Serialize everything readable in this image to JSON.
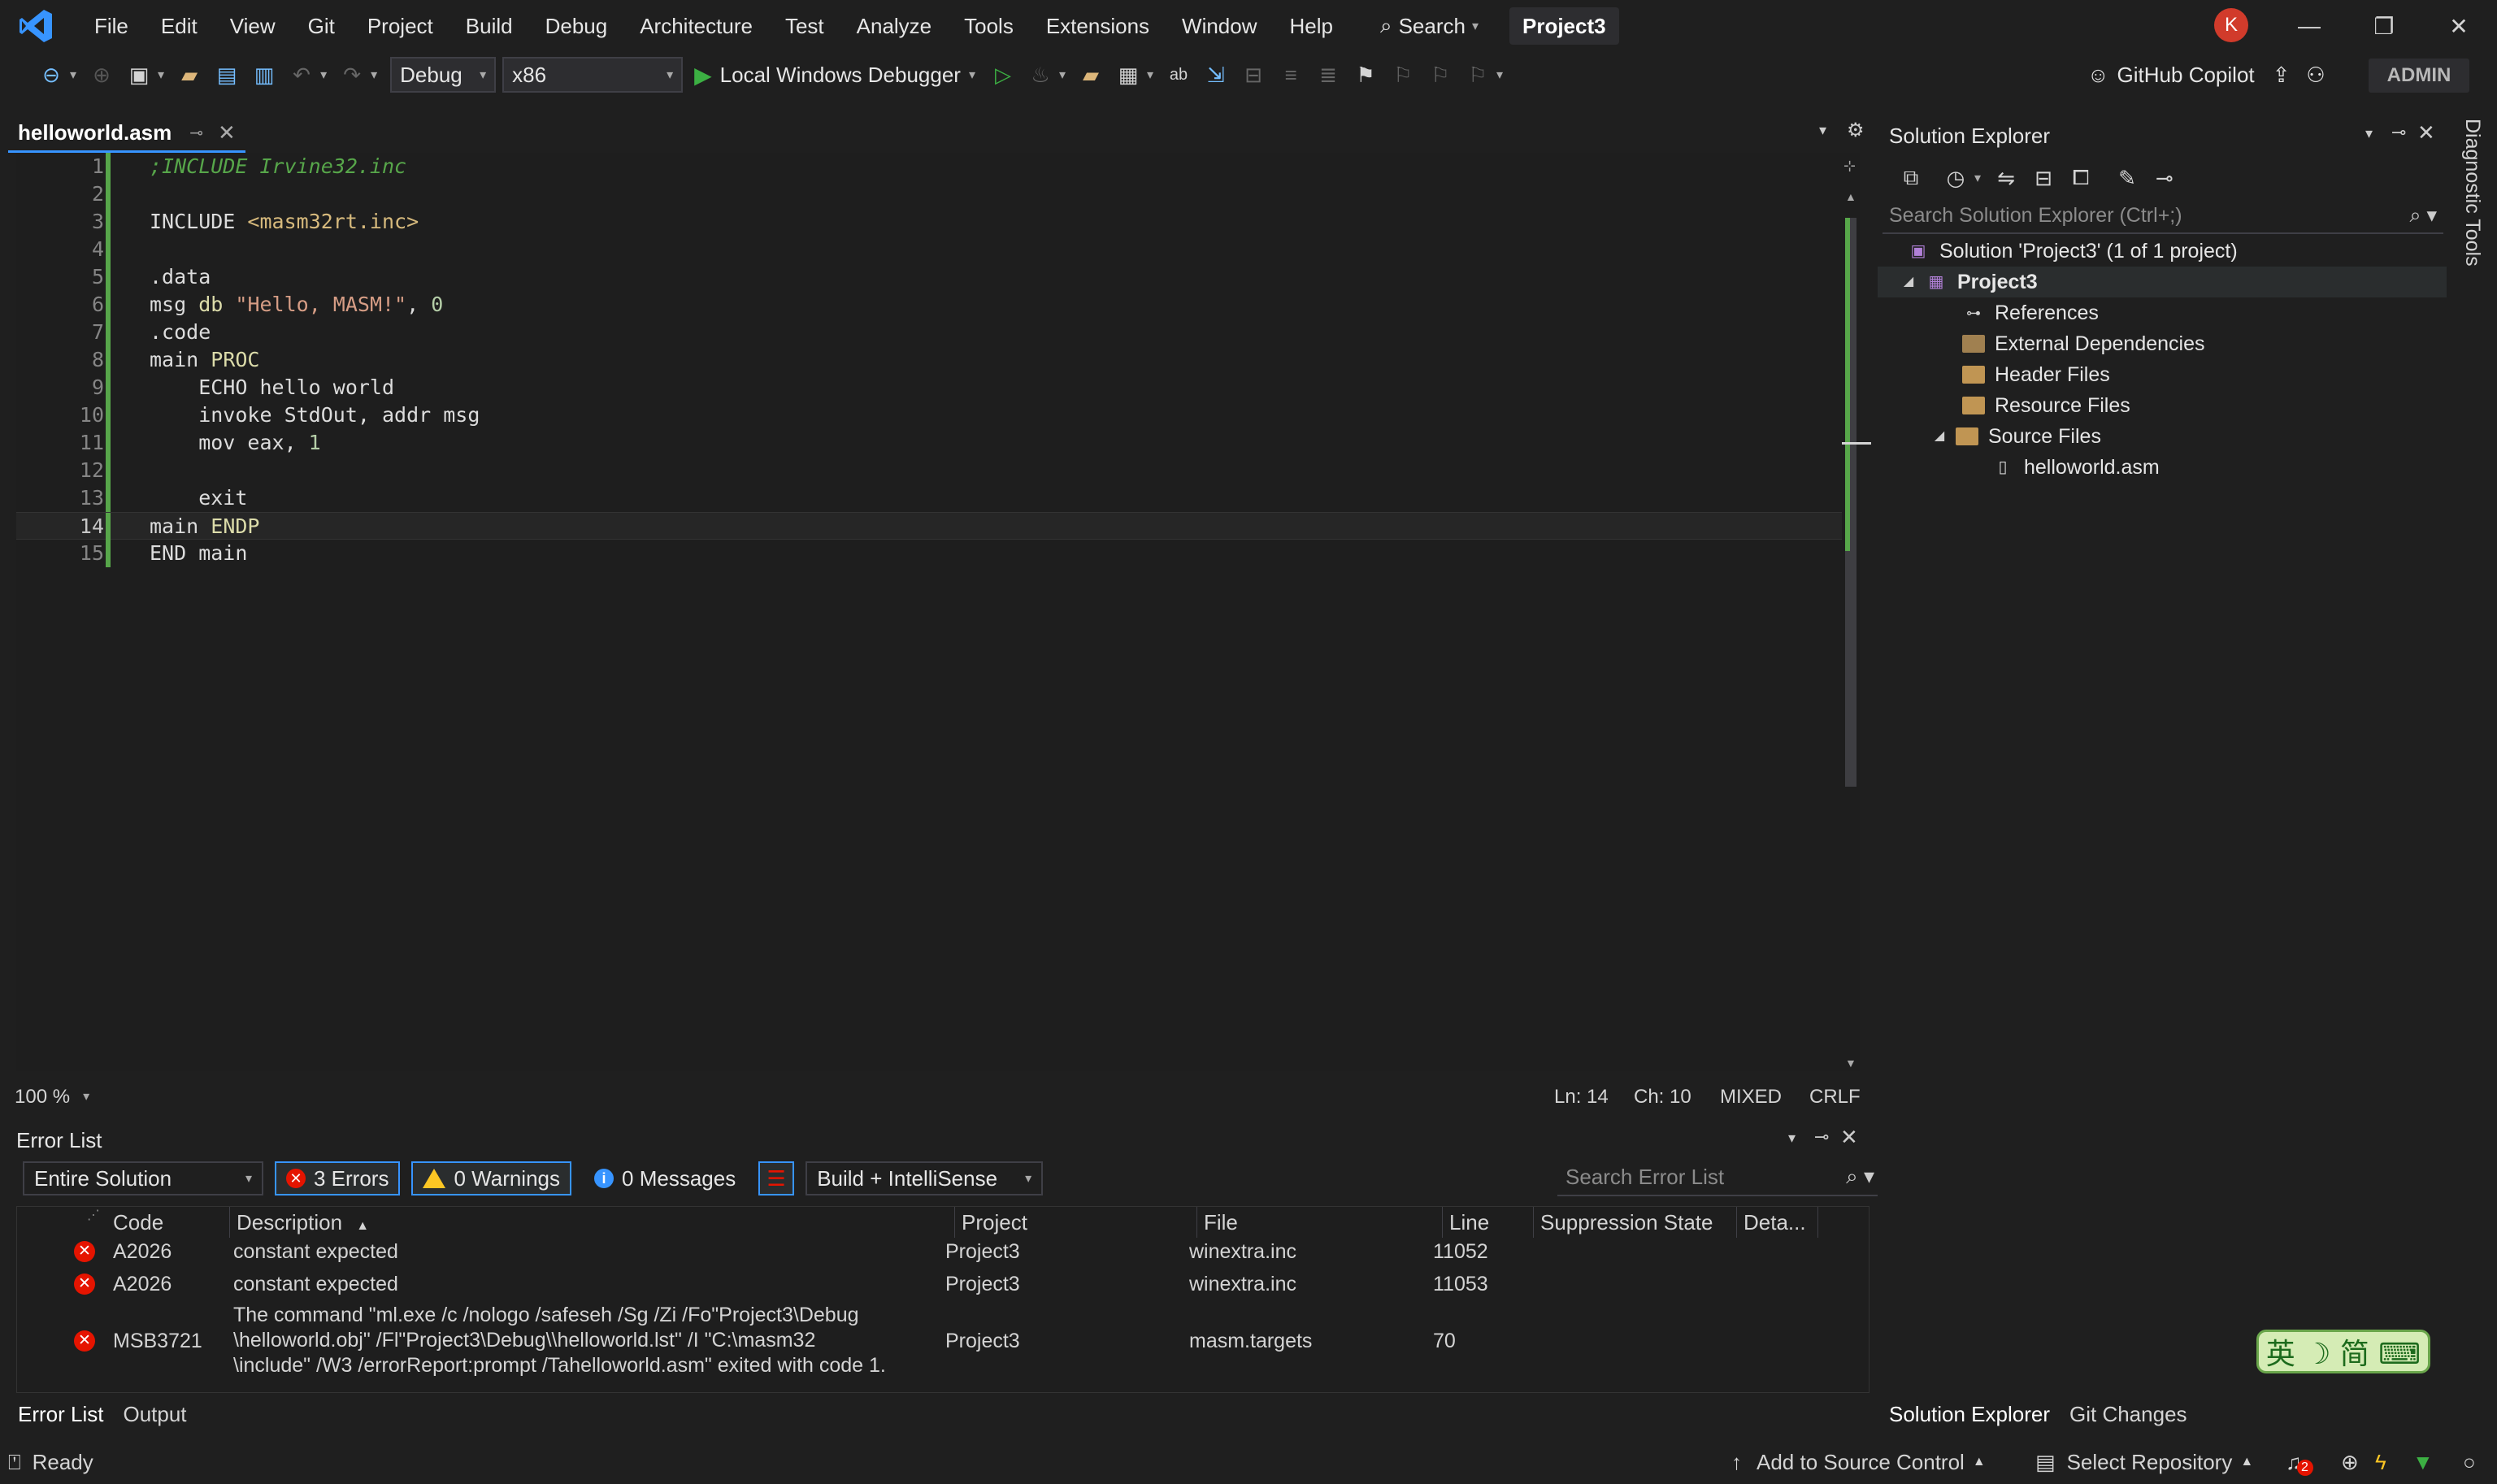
{
  "menu": {
    "items": [
      "File",
      "Edit",
      "View",
      "Git",
      "Project",
      "Build",
      "Debug",
      "Architecture",
      "Test",
      "Analyze",
      "Tools",
      "Extensions",
      "Window",
      "Help"
    ],
    "search_label": "Search",
    "project_name": "Project3",
    "avatar_initial": "K"
  },
  "toolbar": {
    "config": "Debug",
    "platform": "x86",
    "run_label": "Local Windows Debugger",
    "copilot_label": "GitHub Copilot",
    "admin_label": "ADMIN"
  },
  "editor": {
    "tab_name": "helloworld.asm",
    "current_line": 14,
    "lines": [
      {
        "n": "1",
        "text": ";INCLUDE Irvine32.inc"
      },
      {
        "n": "2",
        "text": ""
      },
      {
        "n": "3",
        "text": "INCLUDE <masm32rt.inc>"
      },
      {
        "n": "4",
        "text": ""
      },
      {
        "n": "5",
        "text": ".data"
      },
      {
        "n": "6",
        "text": "msg db \"Hello, MASM!\", 0"
      },
      {
        "n": "7",
        "text": ".code"
      },
      {
        "n": "8",
        "text": "main PROC"
      },
      {
        "n": "9",
        "text": "    ECHO hello world"
      },
      {
        "n": "10",
        "text": "    invoke StdOut, addr msg"
      },
      {
        "n": "11",
        "text": "    mov eax, 1"
      },
      {
        "n": "12",
        "text": ""
      },
      {
        "n": "13",
        "text": "    exit"
      },
      {
        "n": "14",
        "text": "main ENDP"
      },
      {
        "n": "15",
        "text": "END main"
      }
    ],
    "zoom": "100 %",
    "ln": "Ln: 14",
    "ch": "Ch: 10",
    "encoding": "MIXED",
    "line_ending": "CRLF"
  },
  "error_list": {
    "title": "Error List",
    "scope": "Entire Solution",
    "errors_label": "3 Errors",
    "warnings_label": "0 Warnings",
    "messages_label": "0 Messages",
    "source_filter": "Build + IntelliSense",
    "search_placeholder": "Search Error List",
    "columns": [
      "Code",
      "Description",
      "Project",
      "File",
      "Line",
      "Suppression State",
      "Deta..."
    ],
    "rows": [
      {
        "code": "A2026",
        "desc1": "constant expected",
        "desc2": "",
        "desc3": "",
        "project": "Project3",
        "file": "winextra.inc",
        "line": "11052"
      },
      {
        "code": "A2026",
        "desc1": "constant expected",
        "desc2": "",
        "desc3": "",
        "project": "Project3",
        "file": "winextra.inc",
        "line": "11053"
      },
      {
        "code": "MSB3721",
        "desc1": "The command \"ml.exe /c /nologo /safeseh /Sg /Zi /Fo\"Project3\\Debug",
        "desc2": "\\helloworld.obj\" /Fl\"Project3\\Debug\\\\helloworld.lst\" /I \"C:\\masm32",
        "desc3": "\\include\" /W3 /errorReport:prompt  /Tahelloworld.asm\" exited with code 1.",
        "project": "Project3",
        "file": "masm.targets",
        "line": "70"
      }
    ],
    "bottom_tabs": [
      "Error List",
      "Output"
    ]
  },
  "solution_explorer": {
    "title": "Solution Explorer",
    "search_placeholder": "Search Solution Explorer (Ctrl+;)",
    "solution": "Solution 'Project3' (1 of 1 project)",
    "project": "Project3",
    "references": "References",
    "external_deps": "External Dependencies",
    "header_files": "Header Files",
    "resource_files": "Resource Files",
    "source_files": "Source Files",
    "file": "helloworld.asm",
    "tabs": [
      "Solution Explorer",
      "Git Changes"
    ]
  },
  "side_tab": "Diagnostic Tools",
  "ime_label": "英 ☽ 简 ⌨",
  "statusbar": {
    "ready": "Ready",
    "source_control": "Add to Source Control",
    "repository": "Select Repository",
    "notif_count": "2"
  }
}
